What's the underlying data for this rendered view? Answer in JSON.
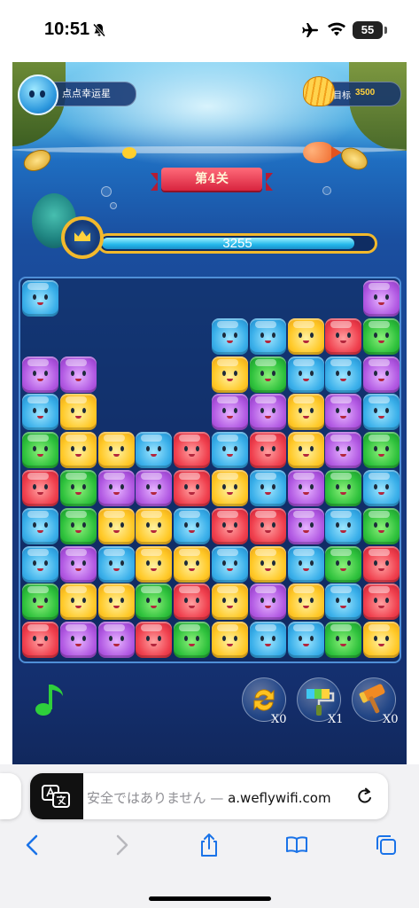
{
  "status_bar": {
    "time": "10:51",
    "battery": "55"
  },
  "game": {
    "player_name": "点点幸运星",
    "target_label": "目标",
    "target_value": "3500",
    "level_title": "第4关",
    "score": "3255",
    "score_progress": 0.93,
    "tools": [
      {
        "name": "shuffle",
        "count": "X0"
      },
      {
        "name": "paint-brush",
        "count": "X1"
      },
      {
        "name": "hammer",
        "count": "X0"
      }
    ],
    "board": {
      "columns": 10,
      "rows": 10,
      "tiles": [
        "B........P",
        ".....BBYRG",
        "PP...YGBBP",
        "BY...PPYPB",
        "GYYBRBRYPG",
        "RGPPRYBPGB",
        "BGYYBRRPBG",
        "BPBYYBYBGR",
        "GYYGRYPYBR",
        "RPPRGYBBGY"
      ]
    }
  },
  "browser": {
    "url_prefix": "安全ではありません — ",
    "url_domain": "a.weflywifi.com"
  }
}
